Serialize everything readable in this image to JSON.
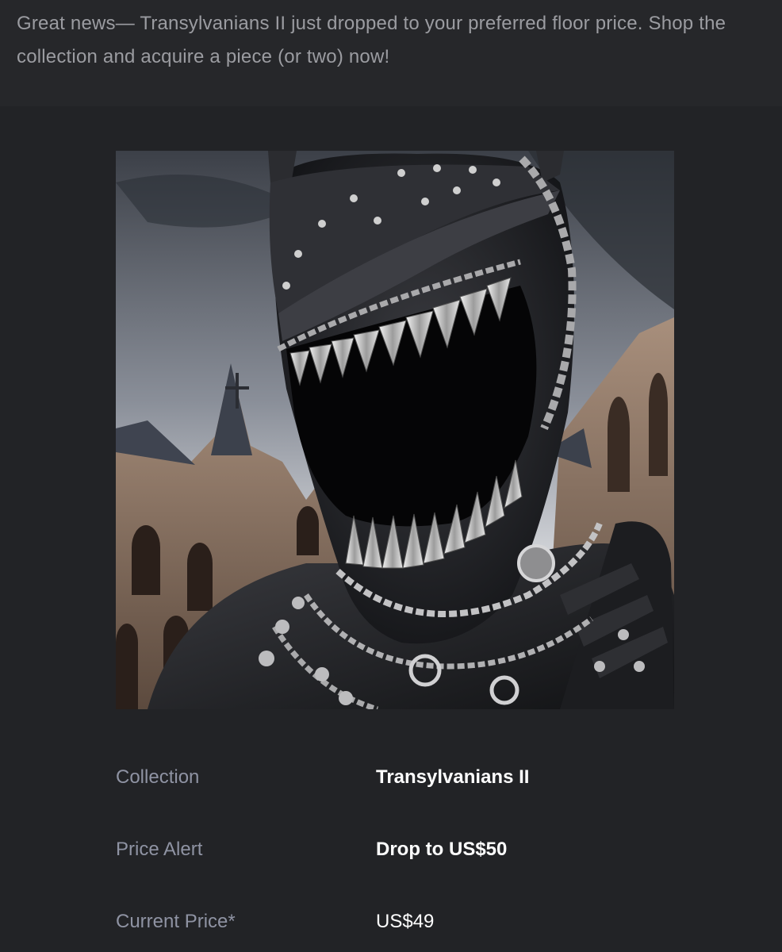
{
  "notice": {
    "text": "Great news— Transylvanians II just dropped to your preferred floor price. Shop the collection and acquire a piece (or two) now!"
  },
  "artwork": {
    "icon": "nft-artwork-image"
  },
  "details": {
    "collection_label": "Collection",
    "collection_value": "Transylvanians II",
    "alert_label": "Price Alert",
    "alert_value": "Drop to US$50",
    "current_label": "Current Price*",
    "current_value": "US$49"
  },
  "colors": {
    "background": "#222326",
    "notice_band": "#26272a",
    "label": "#8f93a3",
    "value": "#ffffff",
    "notice_text": "#9b9ca1"
  }
}
